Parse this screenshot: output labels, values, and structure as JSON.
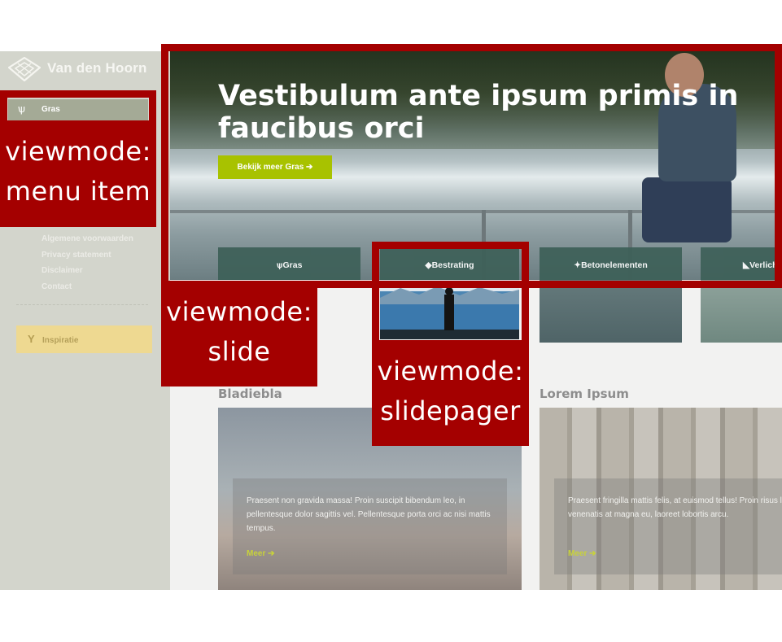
{
  "brand": {
    "name": "Van den Hoorn"
  },
  "sidebar": {
    "active_item": {
      "label": "Gras",
      "icon": "grass-icon"
    },
    "links": [
      "Algemene voorwaarden",
      "Privacy statement",
      "Disclaimer",
      "Contact"
    ],
    "inspiratie": {
      "label": "Inspiratie",
      "icon": "sprout-icon"
    }
  },
  "hero": {
    "title": "Vestibulum ante ipsum primis in faucibus orci",
    "button": "Bekijk meer Gras",
    "button_arrow": "➔"
  },
  "pager": {
    "tabs": [
      {
        "label": "Gras",
        "icon": "grass-icon"
      },
      {
        "label": "Bestrating",
        "icon": "pavers-icon"
      },
      {
        "label": "Betonelementen",
        "icon": "concrete-icon"
      },
      {
        "label": "Verlichting",
        "icon": "lamp-icon"
      }
    ]
  },
  "sections": [
    {
      "title": "Bladiebla",
      "text": "Praesent non gravida massa! Proin suscipit bibendum leo, in pellentesque dolor sagittis vel. Pellentesque porta orci ac nisi mattis tempus.",
      "more": "Meer"
    },
    {
      "title": "Lorem Ipsum",
      "text": "Praesent fringilla mattis felis, at euismod tellus! Proin risus lacus, venenatis at magna eu, laoreet lobortis arcu.",
      "more": "Meer"
    }
  ],
  "annotations": {
    "menu_item": [
      "viewmode:",
      "menu item"
    ],
    "slide": [
      "viewmode:",
      "slide"
    ],
    "slidepager": [
      "viewmode:",
      "slidepager"
    ]
  },
  "colors": {
    "annotation": "#a40000",
    "accent_green": "#a8c200",
    "sidebar_bg": "#d3d5cc",
    "inspiratie_bg": "#eed991"
  }
}
